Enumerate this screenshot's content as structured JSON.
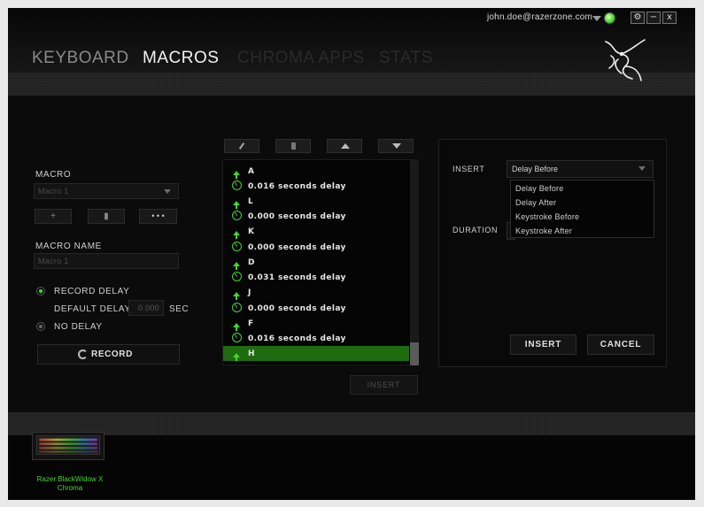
{
  "header": {
    "user_email": "john.doe@razerzone.com",
    "window_buttons": {
      "settings": "⚙",
      "minimize": "−",
      "close": "x"
    },
    "tabs": [
      {
        "label": "KEYBOARD",
        "state": "inactive"
      },
      {
        "label": "MACROS",
        "state": "active"
      },
      {
        "label": "CHROMA APPS",
        "state": "disabled"
      },
      {
        "label": "STATS",
        "state": "disabled"
      }
    ]
  },
  "left_panel": {
    "macro_label": "MACRO",
    "macro_select_value": "Macro 1",
    "buttons": {
      "add": "+",
      "delete": "▮",
      "more": "• • •"
    },
    "macro_name_label": "MACRO NAME",
    "macro_name_value": "Macro 1",
    "record_delay_label": "RECORD DELAY",
    "default_delay_label": "DEFAULT DELAY",
    "default_delay_value": "0.000",
    "sec_label": "SEC",
    "no_delay_label": "NO DELAY",
    "record_button": "RECORD",
    "selected_option": "record_delay"
  },
  "macro_list": {
    "rows": [
      {
        "type": "key",
        "text": "A"
      },
      {
        "type": "delay",
        "text": "0.016 seconds delay"
      },
      {
        "type": "key",
        "text": "L"
      },
      {
        "type": "delay",
        "text": "0.000 seconds delay"
      },
      {
        "type": "key",
        "text": "K"
      },
      {
        "type": "delay",
        "text": "0.000 seconds delay"
      },
      {
        "type": "key",
        "text": "D"
      },
      {
        "type": "delay",
        "text": "0.031 seconds delay"
      },
      {
        "type": "key",
        "text": "J"
      },
      {
        "type": "delay",
        "text": "0.000 seconds delay"
      },
      {
        "type": "key",
        "text": "F"
      },
      {
        "type": "delay",
        "text": "0.016 seconds delay"
      },
      {
        "type": "key",
        "text": "H",
        "selected": true
      }
    ],
    "insert_button": "INSERT"
  },
  "right_panel": {
    "insert_label": "INSERT",
    "insert_value": "Delay Before",
    "duration_label": "DURATION",
    "options": [
      "Delay Before",
      "Delay After",
      "Keystroke Before",
      "Keystroke After"
    ],
    "insert_button": "INSERT",
    "cancel_button": "CANCEL"
  },
  "footer": {
    "device_name_line1": "Razer BlackWidow X",
    "device_name_line2": "Chroma"
  },
  "colors": {
    "accent": "#44d62c",
    "selected_row": "#1e6b10",
    "background": "#0b0b0b"
  }
}
